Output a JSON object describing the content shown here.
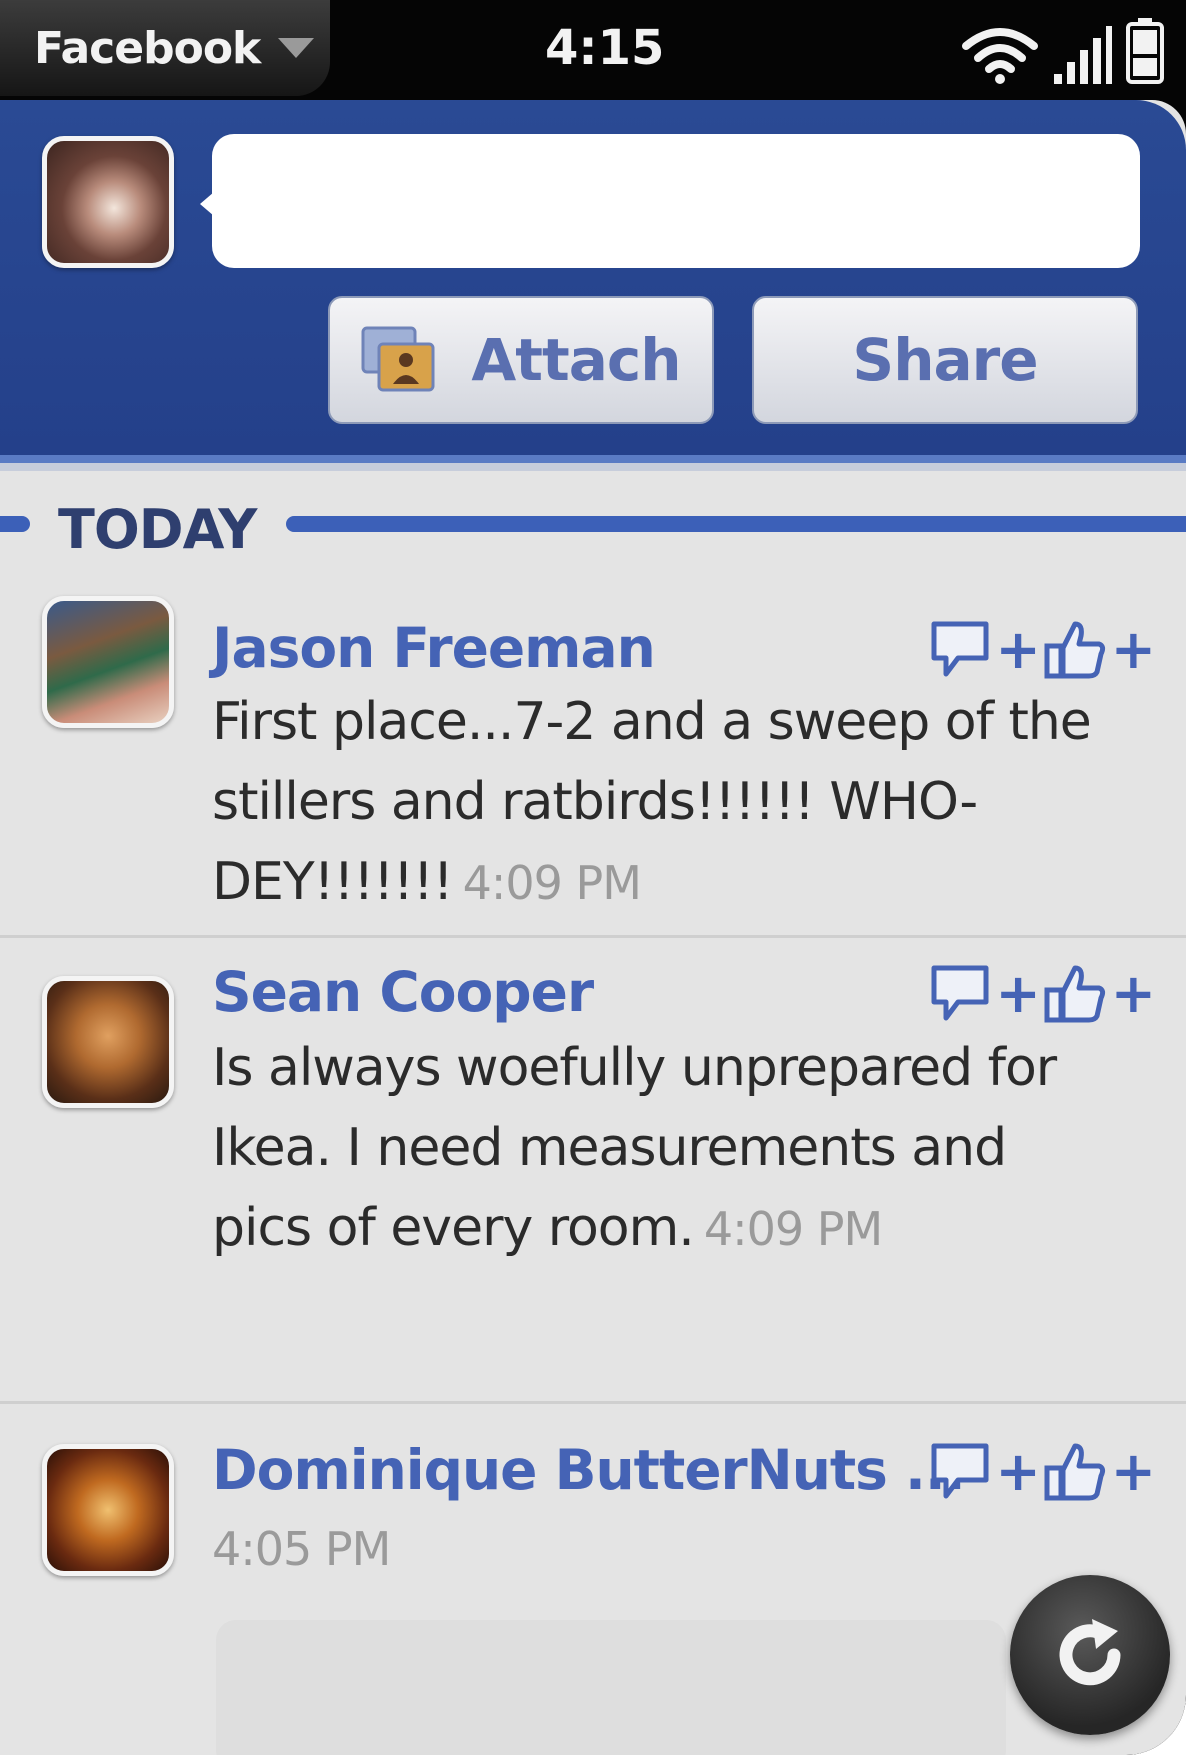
{
  "status_bar": {
    "app_menu_label": "Facebook",
    "clock": "4:15"
  },
  "composer": {
    "status_placeholder": "",
    "attach_label": "Attach",
    "share_label": "Share"
  },
  "feed": {
    "section_label": "TODAY",
    "items": [
      {
        "name": "Jason Freeman",
        "text": "First place...7-2 and a sweep of the stillers and ratbirds!!!!!! WHO-DEY!!!!!!!",
        "time": "4:09 PM"
      },
      {
        "name": "Sean Cooper",
        "text": "Is always woefully unprepared for Ikea. I need measurements and pics of every room.",
        "time": "4:09 PM"
      },
      {
        "name": "Dominique ButterNuts ...",
        "text": "",
        "time": "4:05 PM"
      }
    ]
  },
  "colors": {
    "facebook_blue": "#24408a",
    "link_blue": "#4563b5",
    "timestamp_gray": "#9a9a9a"
  }
}
